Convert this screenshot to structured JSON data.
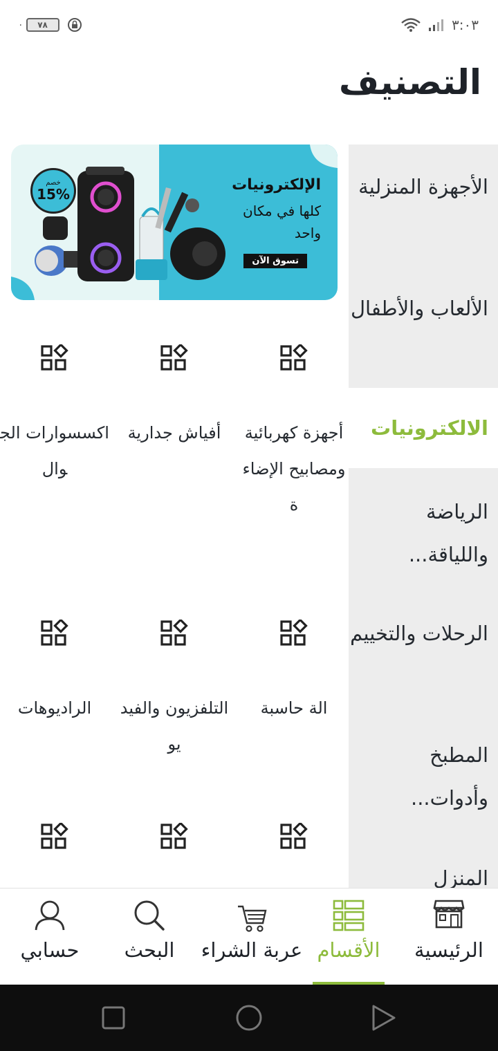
{
  "status_bar": {
    "time": "٣:٠٣",
    "battery": "٧٨",
    "battery_extra": "٠"
  },
  "page_title": "التصنيف",
  "sidebar": {
    "items": [
      {
        "label": "الأجهزة المنزلية",
        "active": false
      },
      {
        "label": "الألعاب والأطفال",
        "active": false
      },
      {
        "label": "الالكترونيات",
        "active": true
      },
      {
        "label": "الرياضة واللياقة...",
        "active": false
      },
      {
        "label": "الرحلات والتخييم",
        "active": false
      },
      {
        "label": "المطبخ وأدوات...",
        "active": false
      },
      {
        "label": "المنزل",
        "active": false
      }
    ]
  },
  "banner": {
    "title": "الإلكترونيات",
    "subtitle": "كلها في مكان واحد",
    "button": "تسوق الآن",
    "discount_small": "خصم",
    "discount_big": "15%"
  },
  "categories": [
    {
      "label": "أجهزة كهربائية ومصابيح الإضاءة",
      "icon": "grid-diamond-icon"
    },
    {
      "label": "أفياش جدارية",
      "icon": "grid-diamond-icon"
    },
    {
      "label": "اكسسوارات الجوال",
      "icon": "grid-diamond-icon"
    },
    {
      "label": "الة حاسبة",
      "icon": "grid-diamond-icon"
    },
    {
      "label": "التلفزيون والفيديو",
      "icon": "grid-diamond-icon"
    },
    {
      "label": "الراديوهات",
      "icon": "grid-diamond-icon"
    },
    {
      "label": "",
      "icon": "grid-diamond-icon"
    },
    {
      "label": "",
      "icon": "grid-diamond-icon"
    },
    {
      "label": "",
      "icon": "grid-diamond-icon"
    }
  ],
  "bottom_nav": {
    "home": "الرئيسية",
    "categories": "الأقسام",
    "cart": "عربة الشراء",
    "search": "البحث",
    "account": "حسابي",
    "active": "categories"
  },
  "colors": {
    "accent": "#8dbb3c",
    "sidebar_bg": "#ededed",
    "banner_blue": "#3cbdd7",
    "text": "#1e2228"
  }
}
